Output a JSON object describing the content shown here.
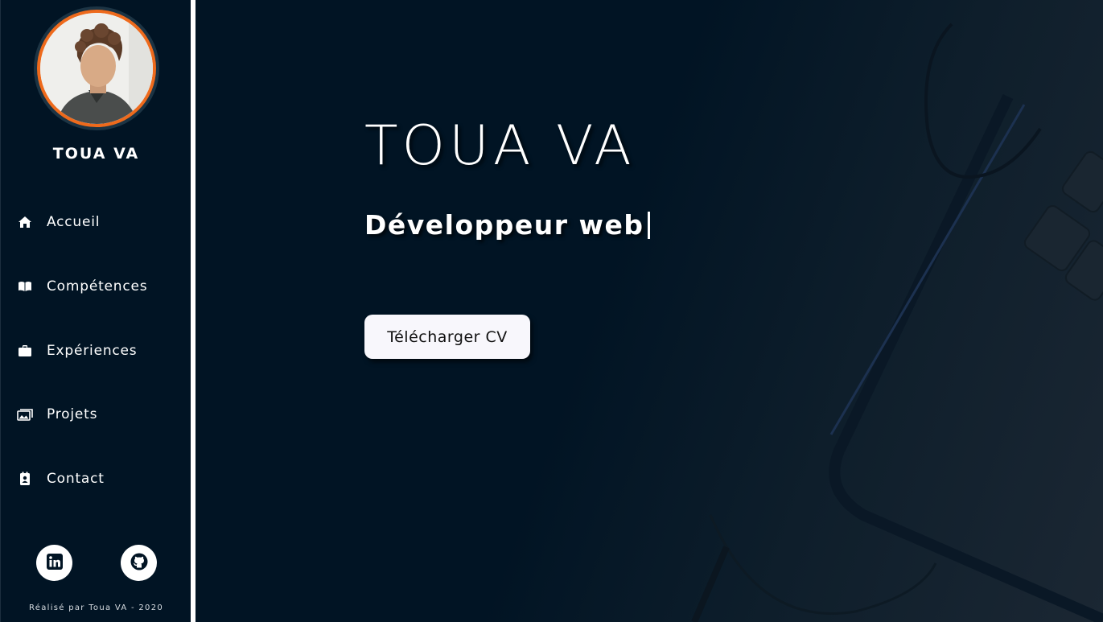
{
  "sidebar": {
    "profile_name": "TOUA VA",
    "nav": [
      {
        "label": "Accueil",
        "icon": "home-icon"
      },
      {
        "label": "Compétences",
        "icon": "book-icon"
      },
      {
        "label": "Expériences",
        "icon": "briefcase-icon"
      },
      {
        "label": "Projets",
        "icon": "images-icon"
      },
      {
        "label": "Contact",
        "icon": "contact-card-icon"
      }
    ],
    "social": [
      {
        "icon": "linkedin-icon"
      },
      {
        "icon": "github-icon"
      }
    ],
    "footer": "Réalisé par Toua VA - 2020"
  },
  "hero": {
    "name": "TOUA VA",
    "subtitle": "Développeur web",
    "cv_button": "Télécharger CV"
  },
  "colors": {
    "background": "#011424",
    "accent_ring": "#ee6a1c",
    "text": "#ffffff",
    "button_bg": "#f8f7fc"
  }
}
